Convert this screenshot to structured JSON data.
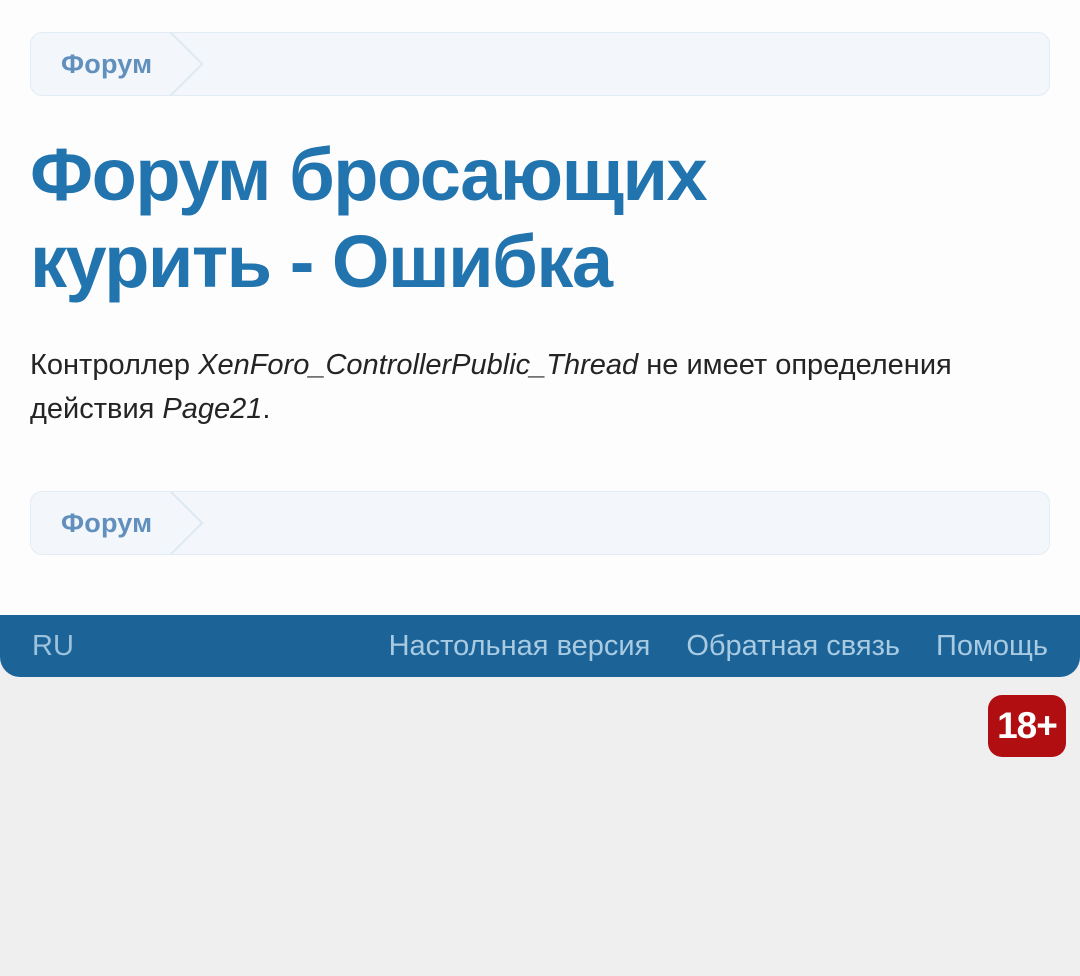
{
  "breadcrumb_top": {
    "items": [
      {
        "label": "Форум"
      }
    ]
  },
  "page": {
    "title": "Форум бросающих курить - Ошибка"
  },
  "error_message": {
    "segments": [
      {
        "text": "Контроллер ",
        "italic": false
      },
      {
        "text": "XenForo_ControllerPublic_Thread",
        "italic": true
      },
      {
        "text": " не имеет определения действия ",
        "italic": false
      },
      {
        "text": "Page21",
        "italic": true
      },
      {
        "text": ".",
        "italic": false
      }
    ]
  },
  "breadcrumb_bottom": {
    "items": [
      {
        "label": "Форум"
      }
    ]
  },
  "footer": {
    "language": "RU",
    "links": [
      {
        "label": "Настольная версия"
      },
      {
        "label": "Обратная связь"
      },
      {
        "label": "Помощь"
      }
    ]
  },
  "age_badge": {
    "label": "18+"
  },
  "colors": {
    "accent_blue": "#2274ae",
    "footer_bar": "#1c6398",
    "breadcrumb_bg": "#f3f7fb",
    "breadcrumb_text": "#6190bd",
    "badge_red": "#b10e11",
    "body_text": "#242424",
    "bottom_gray": "#efefef"
  }
}
